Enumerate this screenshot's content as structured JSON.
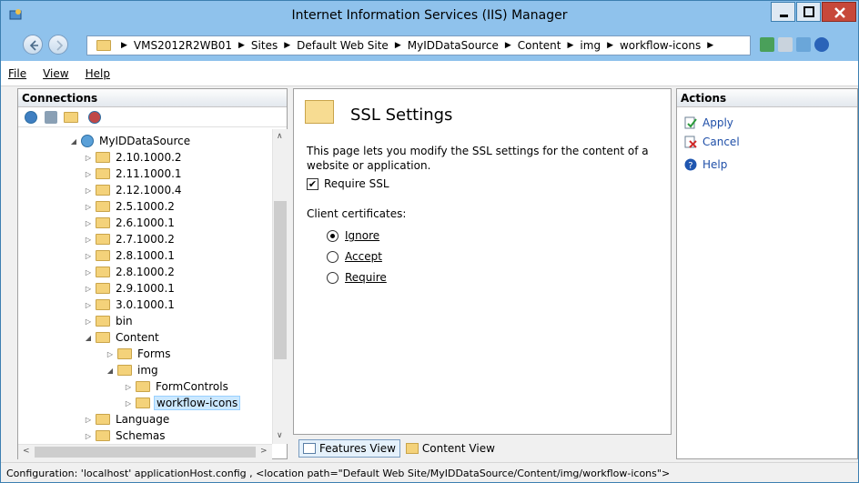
{
  "window": {
    "title": "Internet Information Services (IIS) Manager"
  },
  "breadcrumb": [
    "VMS2012R2WB01",
    "Sites",
    "Default Web Site",
    "MyIDDataSource",
    "Content",
    "img",
    "workflow-icons"
  ],
  "menu": {
    "file": "File",
    "view": "View",
    "help": "Help"
  },
  "connections": {
    "header": "Connections",
    "tree": [
      {
        "label": "MyIDDataSource",
        "depth": 0,
        "arrow": "◢",
        "icon": "globe"
      },
      {
        "label": "2.10.1000.2",
        "depth": 1,
        "arrow": "▷"
      },
      {
        "label": "2.11.1000.1",
        "depth": 1,
        "arrow": "▷"
      },
      {
        "label": "2.12.1000.4",
        "depth": 1,
        "arrow": "▷"
      },
      {
        "label": "2.5.1000.2",
        "depth": 1,
        "arrow": "▷"
      },
      {
        "label": "2.6.1000.1",
        "depth": 1,
        "arrow": "▷"
      },
      {
        "label": "2.7.1000.2",
        "depth": 1,
        "arrow": "▷"
      },
      {
        "label": "2.8.1000.1",
        "depth": 1,
        "arrow": "▷"
      },
      {
        "label": "2.8.1000.2",
        "depth": 1,
        "arrow": "▷"
      },
      {
        "label": "2.9.1000.1",
        "depth": 1,
        "arrow": "▷"
      },
      {
        "label": "3.0.1000.1",
        "depth": 1,
        "arrow": "▷"
      },
      {
        "label": "bin",
        "depth": 1,
        "arrow": "▷"
      },
      {
        "label": "Content",
        "depth": 1,
        "arrow": "◢"
      },
      {
        "label": "Forms",
        "depth": 2,
        "arrow": "▷"
      },
      {
        "label": "img",
        "depth": 2,
        "arrow": "◢"
      },
      {
        "label": "FormControls",
        "depth": 3,
        "arrow": "▷"
      },
      {
        "label": "workflow-icons",
        "depth": 3,
        "arrow": "▷",
        "selected": true
      },
      {
        "label": "Language",
        "depth": 1,
        "arrow": "▷"
      },
      {
        "label": "Schemas",
        "depth": 1,
        "arrow": "▷"
      }
    ]
  },
  "content": {
    "title": "SSL Settings",
    "description": "This page lets you modify the SSL settings for the content of a website or application.",
    "require_ssl": "Require SSL",
    "client_certificates": "Client certificates:",
    "options": [
      {
        "label": "Ignore",
        "selected": true
      },
      {
        "label": "Accept",
        "selected": false
      },
      {
        "label": "Require",
        "selected": false
      }
    ]
  },
  "view_tabs": {
    "features": "Features View",
    "content": "Content View"
  },
  "actions": {
    "header": "Actions",
    "apply": "Apply",
    "cancel": "Cancel",
    "help": "Help"
  },
  "status": "Configuration: 'localhost' applicationHost.config , <location path=\"Default Web Site/MyIDDataSource/Content/img/workflow-icons\">"
}
